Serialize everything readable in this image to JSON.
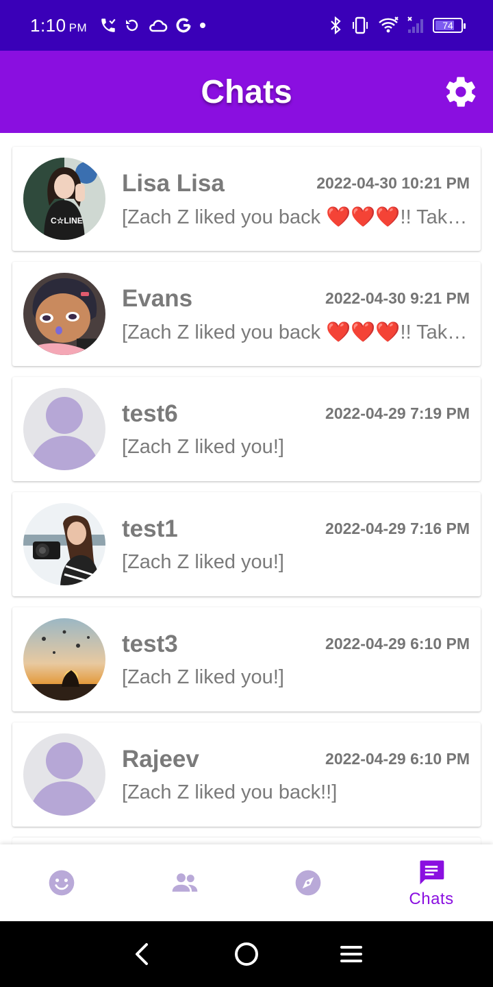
{
  "status_bar": {
    "time": "1:10",
    "ampm": "PM",
    "battery_level": "74",
    "battery_fraction": 0.74,
    "left_icons": [
      "wifi-call-icon",
      "sync-icon",
      "cloud-icon",
      "google-icon",
      "dot-icon"
    ],
    "right_icons": [
      "bluetooth-icon",
      "vibrate-icon",
      "wifi-icon",
      "signal-icon",
      "battery-icon"
    ]
  },
  "header": {
    "title": "Chats",
    "settings_icon": "gear-icon"
  },
  "colors": {
    "status_bar": "#3a00b8",
    "header": "#8a0fe0",
    "accent": "#8a0fe0",
    "inactive_icon": "#b9a9d8",
    "text_gray": "#7a7a7a"
  },
  "chats": [
    {
      "name": "Lisa Lisa",
      "time": "2022-04-30 10:21 PM",
      "message": "[Zach Z liked you back ❤️❤️❤️!! Take a chance and say hi!]",
      "avatar": "photo-woman-waving"
    },
    {
      "name": "Evans",
      "time": "2022-04-30 9:21 PM",
      "message": "[Zach Z liked you back ❤️❤️❤️!! Take a chance and say hi!]",
      "avatar": "cartoon-girl"
    },
    {
      "name": "test6",
      "time": "2022-04-29 7:19 PM",
      "message": "[Zach Z liked you!]",
      "avatar": "default-person-avatar"
    },
    {
      "name": "test1",
      "time": "2022-04-29 7:16 PM",
      "message": "[Zach Z liked you!]",
      "avatar": "photo-woman-camera"
    },
    {
      "name": "test3",
      "time": "2022-04-29 6:10 PM",
      "message": "[Zach Z liked you!]",
      "avatar": "photo-sunset-balloons"
    },
    {
      "name": "Rajeev",
      "time": "2022-04-29 6:10 PM",
      "message": "[Zach Z liked you back!!]",
      "avatar": "default-person-avatar"
    }
  ],
  "bottom_nav": {
    "items": [
      {
        "icon": "smiley-icon",
        "label": "",
        "active": false
      },
      {
        "icon": "people-icon",
        "label": "",
        "active": false
      },
      {
        "icon": "compass-icon",
        "label": "",
        "active": false
      },
      {
        "icon": "chat-icon",
        "label": "Chats",
        "active": true
      }
    ]
  },
  "system_nav": {
    "buttons": [
      "back-icon",
      "home-icon",
      "menu-icon"
    ]
  }
}
